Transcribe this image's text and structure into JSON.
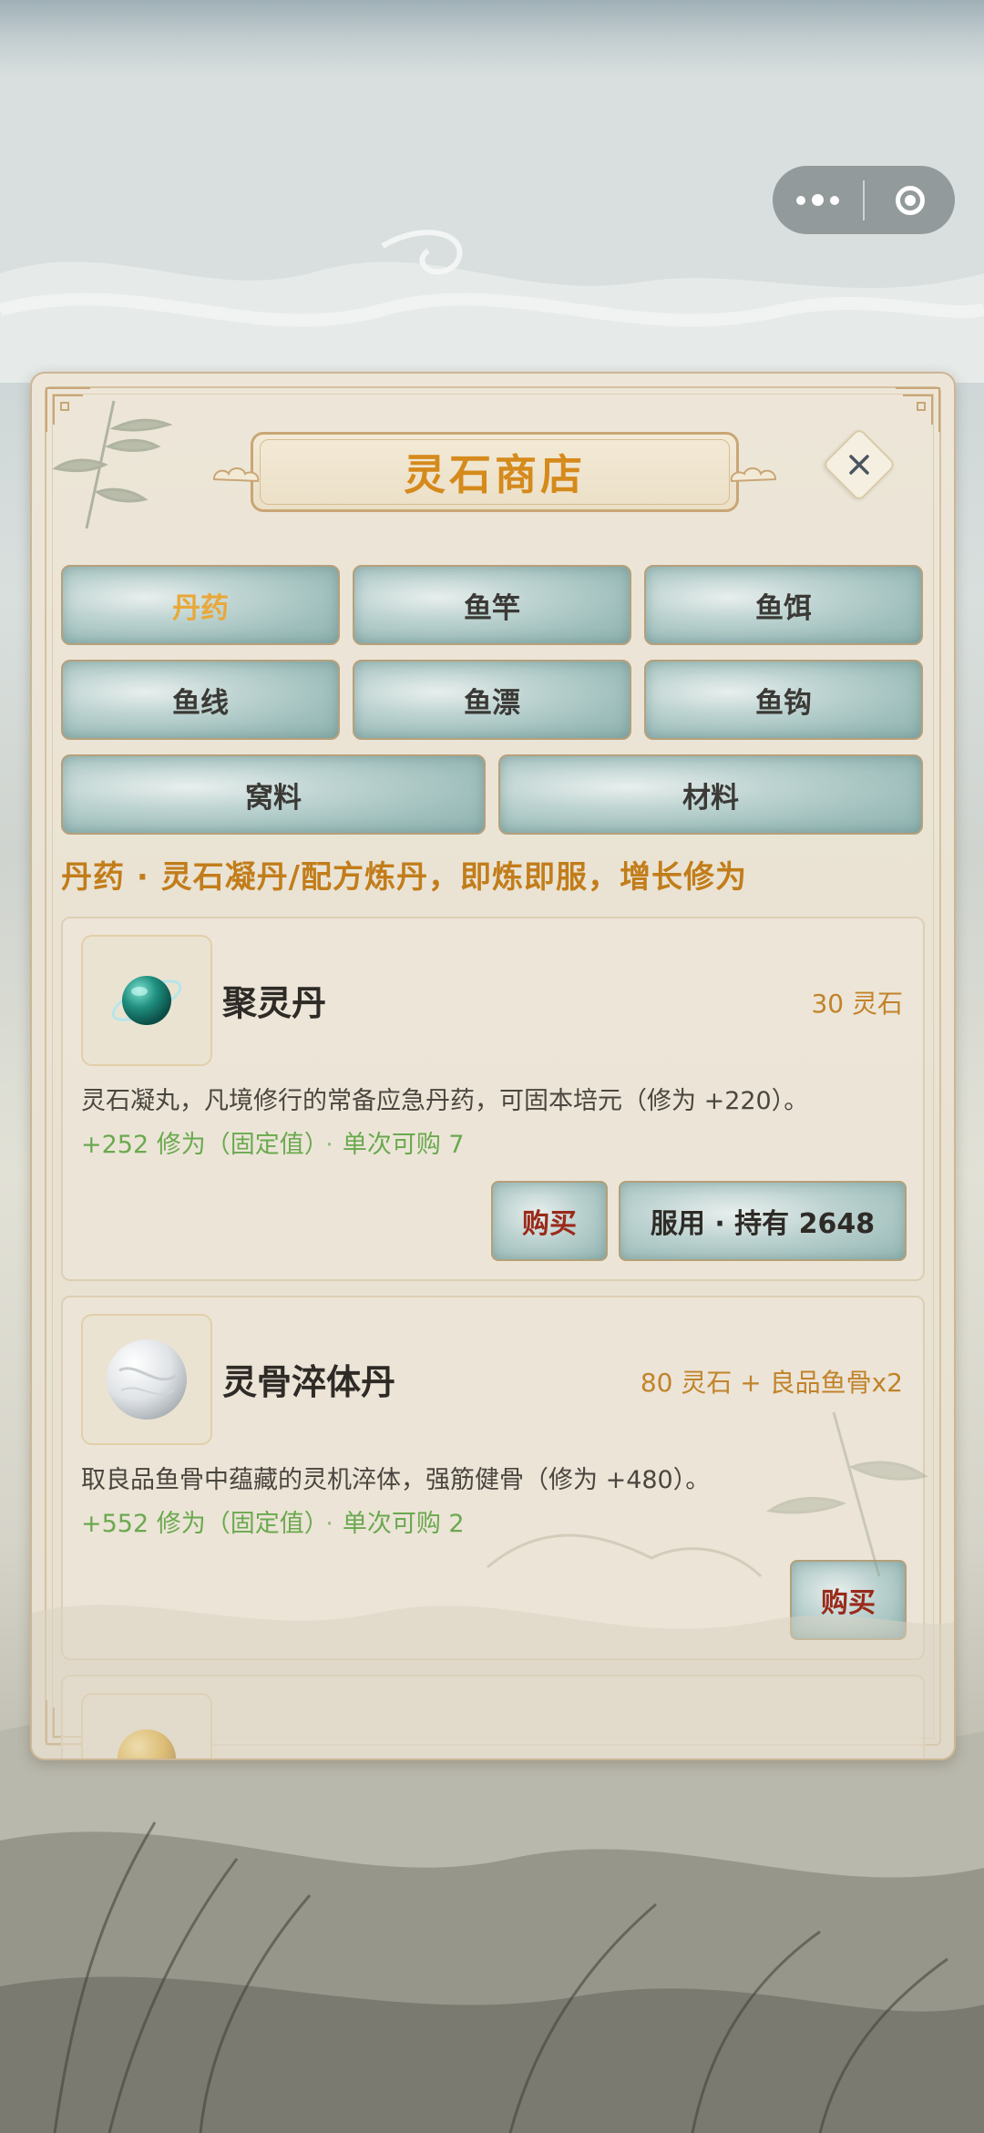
{
  "capsule": {
    "more_icon": "more-dots-icon",
    "close_icon": "target-close-icon"
  },
  "shop": {
    "title": "灵石商店",
    "close_icon": "close-x-icon",
    "tabs": [
      {
        "label": "丹药",
        "active": true
      },
      {
        "label": "鱼竿",
        "active": false
      },
      {
        "label": "鱼饵",
        "active": false
      },
      {
        "label": "鱼线",
        "active": false
      },
      {
        "label": "鱼漂",
        "active": false
      },
      {
        "label": "鱼钩",
        "active": false
      },
      {
        "label": "窝料",
        "active": false
      },
      {
        "label": "材料",
        "active": false
      }
    ],
    "category_desc": "丹药 · 灵石凝丹/配方炼丹，即炼即服，增长修为",
    "items": [
      {
        "name": "聚灵丹",
        "price": "30 灵石",
        "desc": "灵石凝丸，凡境修行的常备应急丹药，可固本培元（修为 +220）。",
        "gain": "+252 修为（固定值）",
        "sep": "·",
        "limit": "单次可购 7",
        "buy_label": "购买",
        "use_label": "服用 · 持有 2648",
        "icon": "jade-pill-icon"
      },
      {
        "name": "灵骨淬体丹",
        "price": "80 灵石 + 良品鱼骨x2",
        "desc": "取良品鱼骨中蕴藏的灵机淬体，强筋健骨（修为 +480）。",
        "gain": "+552 修为（固定值）",
        "sep": "·",
        "limit": "单次可购 2",
        "buy_label": "购买",
        "icon": "white-pearl-pill-icon"
      },
      {
        "icon": "golden-pill-icon"
      }
    ],
    "colors": {
      "accent_gold": "#d58a1c",
      "active_tab": "#e8a83a",
      "buy_red": "#9a2a1a",
      "gain_green": "#6aa94f"
    }
  }
}
